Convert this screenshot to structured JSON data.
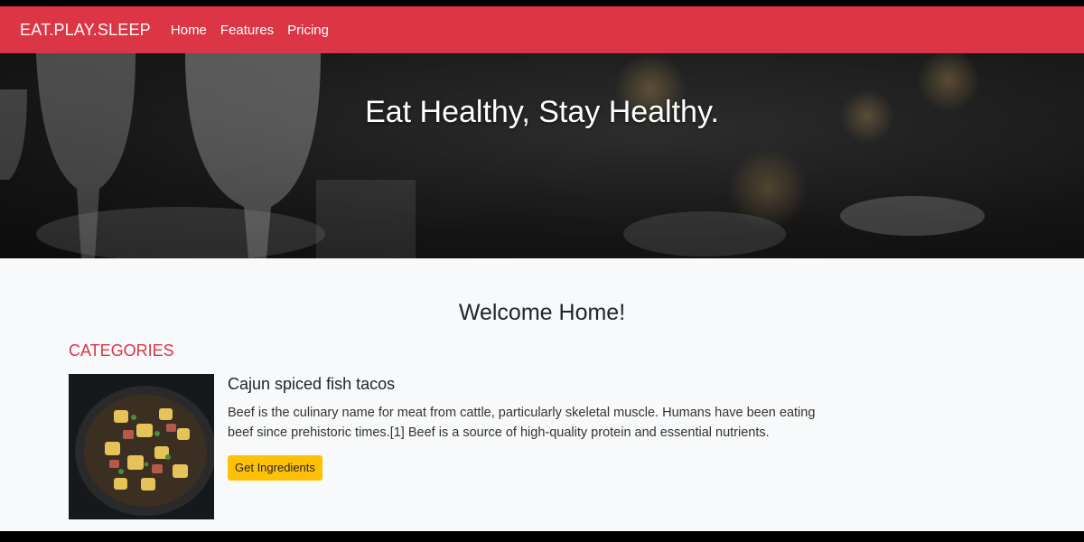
{
  "navbar": {
    "brand": "EAT.PLAY.SLEEP",
    "links": [
      "Home",
      "Features",
      "Pricing"
    ],
    "color": "#dc3545"
  },
  "hero": {
    "title": "Eat Healthy, Stay Healthy."
  },
  "main": {
    "welcome": "Welcome Home!",
    "section_heading": "CATEGORIES",
    "card": {
      "title": "Cajun spiced fish tacos",
      "text": "Beef is the culinary name for meat from cattle, particularly skeletal muscle. Humans have been eating beef since prehistoric times.[1] Beef is a source of high-quality protein and essential nutrients.",
      "button": "Get Ingredients",
      "button_color": "#ffc107"
    }
  }
}
